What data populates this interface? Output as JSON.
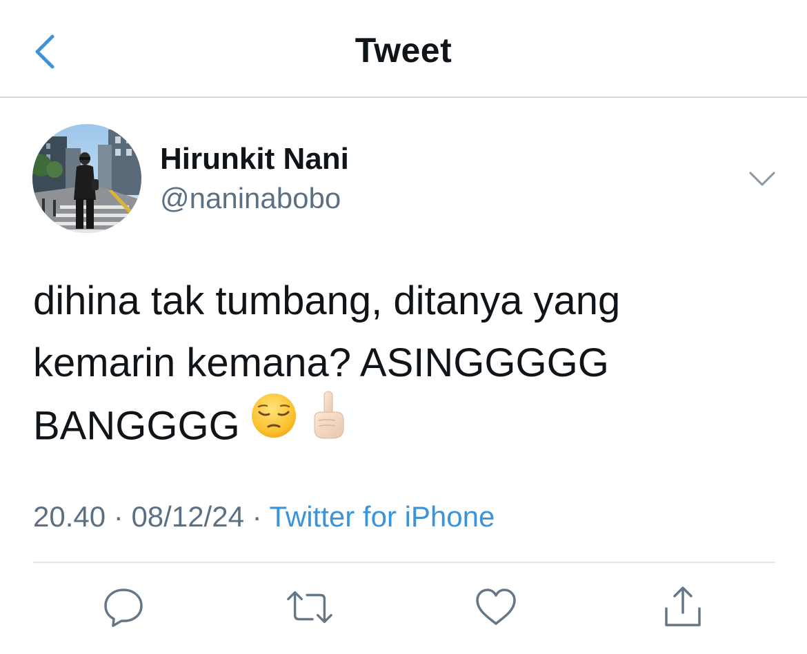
{
  "header": {
    "title": "Tweet",
    "back_icon": "chevron-left-icon"
  },
  "author": {
    "display_name": "Hirunkit Nani",
    "handle": "@naninabobo"
  },
  "tweet": {
    "lines": [
      "dihina tak tumbang, ditanya yang",
      "kemarin kemana? ASINGGGGG",
      "BANGGGG"
    ],
    "emojis": [
      "pensive-face-icon",
      "index-pointing-up-icon"
    ]
  },
  "meta": {
    "time": "20.40",
    "separator": "·",
    "date": "08/12/24",
    "source": "Twitter for iPhone"
  },
  "actions": [
    "reply-icon",
    "retweet-icon",
    "like-icon",
    "share-icon"
  ],
  "colors": {
    "accent": "#3b94d9",
    "secondary_text": "#5b7083",
    "icon": "#657786"
  }
}
